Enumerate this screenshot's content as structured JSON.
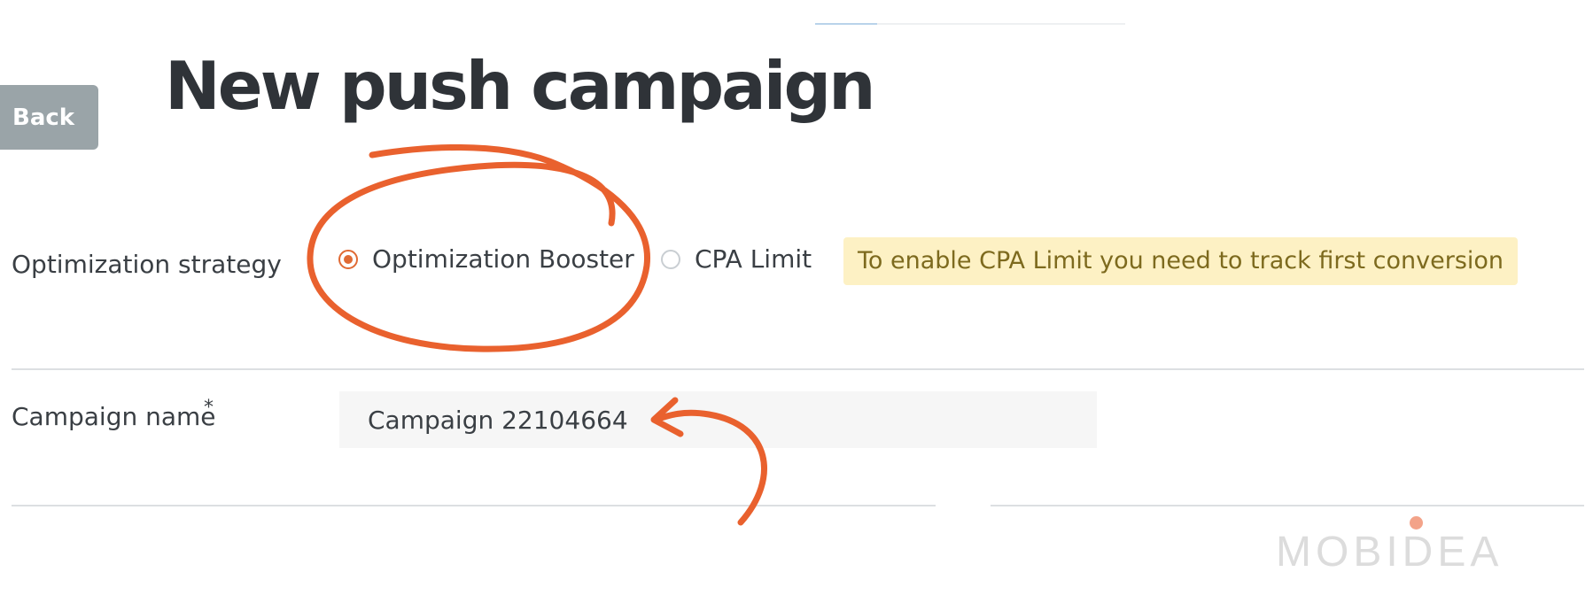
{
  "header": {
    "back_label": "Back",
    "title": "New push campaign"
  },
  "form": {
    "strategy": {
      "label": "Optimization strategy",
      "options": [
        {
          "label": "Optimization Booster",
          "selected": true
        },
        {
          "label": "CPA Limit",
          "selected": false
        }
      ],
      "notice": "To enable CPA Limit you need to track first conversion"
    },
    "campaign_name": {
      "label": "Campaign name",
      "required_mark": "*",
      "value": "Campaign 22104664"
    }
  },
  "watermark": {
    "text": "MOBIDEA"
  },
  "colors": {
    "accent": "#e06a34",
    "annotation": "#e9612e",
    "back_button": "#9aa4a8",
    "notice_bg": "#fdf1c4"
  },
  "icons": {
    "radio_selected": "radio-selected-icon",
    "radio_unselected": "radio-unselected-icon"
  }
}
